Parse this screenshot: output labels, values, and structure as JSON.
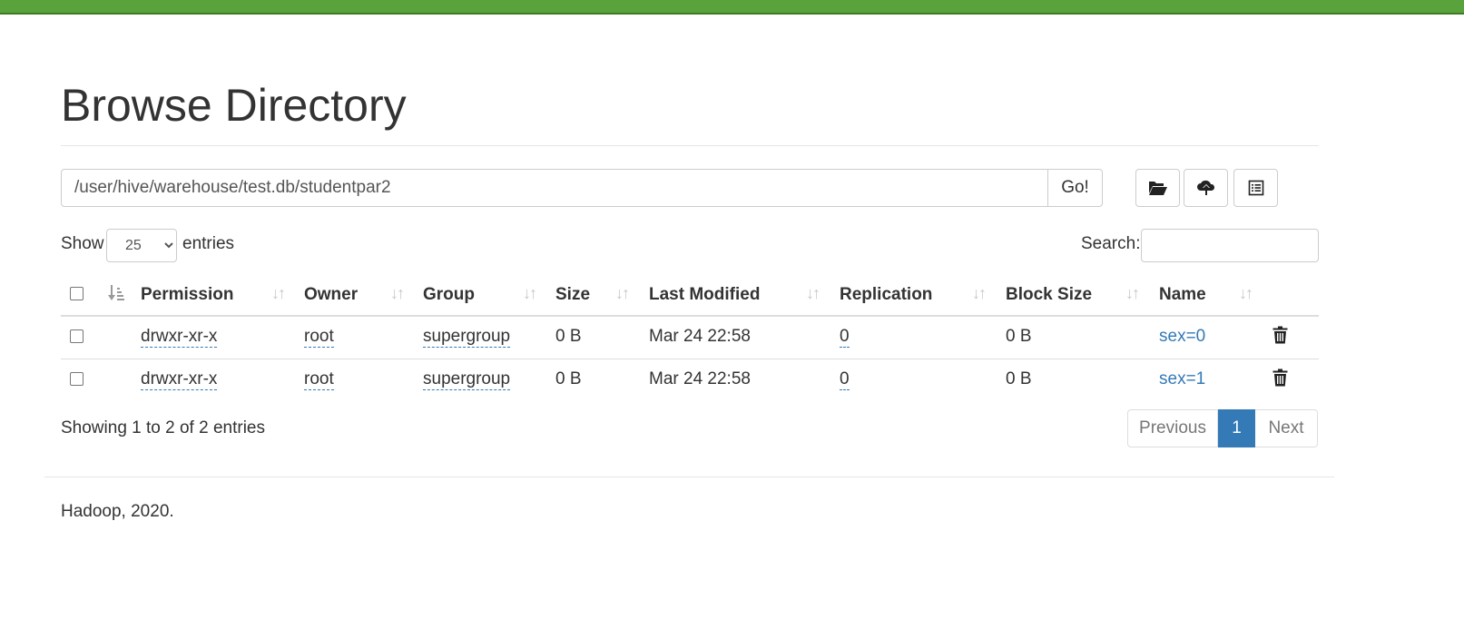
{
  "header": {
    "title": "Browse Directory"
  },
  "path_bar": {
    "value": "/user/hive/warehouse/test.db/studentpar2",
    "go_label": "Go!"
  },
  "toolbar": {
    "icons": [
      "folder-open-icon",
      "cloud-upload-icon",
      "list-alt-icon"
    ]
  },
  "length_menu": {
    "show_label": "Show",
    "selected": "25",
    "entries_label": "entries"
  },
  "search": {
    "label": "Search:",
    "value": ""
  },
  "table": {
    "columns": [
      "Permission",
      "Owner",
      "Group",
      "Size",
      "Last Modified",
      "Replication",
      "Block Size",
      "Name"
    ],
    "rows": [
      {
        "permission": "drwxr-xr-x",
        "owner": "root",
        "group": "supergroup",
        "size": "0 B",
        "last_modified": "Mar 24 22:58",
        "replication": "0",
        "block_size": "0 B",
        "name": "sex=0"
      },
      {
        "permission": "drwxr-xr-x",
        "owner": "root",
        "group": "supergroup",
        "size": "0 B",
        "last_modified": "Mar 24 22:58",
        "replication": "0",
        "block_size": "0 B",
        "name": "sex=1"
      }
    ]
  },
  "info": "Showing 1 to 2 of 2 entries",
  "pagination": {
    "previous": "Previous",
    "current": "1",
    "next": "Next"
  },
  "footer": {
    "text": "Hadoop, 2020."
  },
  "colors": {
    "top_bar": "#5aa33c",
    "link": "#337ab7",
    "active_page": "#337ab7"
  }
}
